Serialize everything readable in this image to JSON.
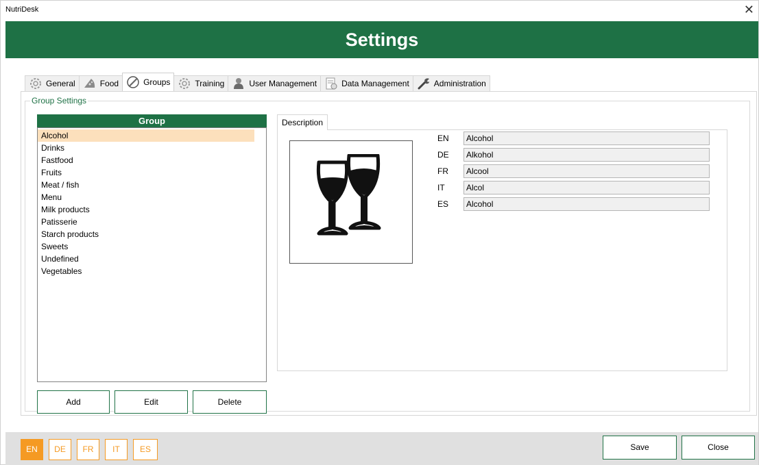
{
  "window": {
    "title": "NutriDesk",
    "close_glyph": "✕"
  },
  "header": {
    "title": "Settings",
    "color": "#1e7145"
  },
  "tabs": [
    {
      "label": "General",
      "icon": "gear-icon"
    },
    {
      "label": "Food",
      "icon": "food-icon"
    },
    {
      "label": "Groups",
      "icon": "groups-icon",
      "active": true
    },
    {
      "label": "Training",
      "icon": "training-icon"
    },
    {
      "label": "User Management",
      "icon": "user-icon"
    },
    {
      "label": "Data Management",
      "icon": "data-icon"
    },
    {
      "label": "Administration",
      "icon": "wrench-icon"
    }
  ],
  "group_settings": {
    "title": "Group Settings",
    "list_header": "Group",
    "items": [
      "Alcohol",
      "Drinks",
      "Fastfood",
      "Fruits",
      "Meat / fish",
      "Menu",
      "Milk products",
      "Patisserie",
      "Starch products",
      "Sweets",
      "Undefined",
      "Vegetables"
    ],
    "selected": "Alcohol",
    "selected_color": "#fce0bc",
    "buttons": {
      "add": "Add",
      "edit": "Edit",
      "delete": "Delete"
    }
  },
  "description": {
    "tab_label": "Description",
    "image_icon": "wine-glasses-icon",
    "languages": [
      {
        "code": "EN",
        "value": "Alcohol"
      },
      {
        "code": "DE",
        "value": "Alkohol"
      },
      {
        "code": "FR",
        "value": "Alcool"
      },
      {
        "code": "IT",
        "value": "Alcol"
      },
      {
        "code": "ES",
        "value": "Alcohol"
      }
    ]
  },
  "footer": {
    "languages": [
      "EN",
      "DE",
      "FR",
      "IT",
      "ES"
    ],
    "active_language": "EN",
    "accent_color": "#f59a23",
    "save": "Save",
    "close": "Close"
  }
}
